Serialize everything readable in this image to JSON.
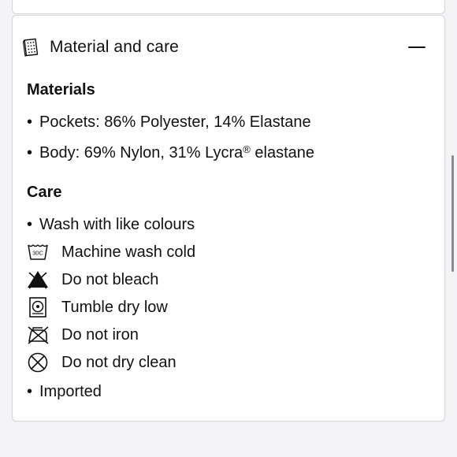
{
  "accordion": {
    "title": "Material and care",
    "icon": "care-label-icon",
    "expanded": true,
    "toggle_icon": "minus-icon"
  },
  "materials": {
    "heading": "Materials",
    "items": [
      {
        "bullet": "•",
        "text": "Pockets: 86% Polyester, 14% Elastane"
      },
      {
        "bullet": "•",
        "text": "Body: 69% Nylon, 31% Lycra",
        "registered": "®",
        "suffix": " elastane"
      }
    ]
  },
  "care": {
    "heading": "Care",
    "items": [
      {
        "type": "bullet",
        "bullet": "•",
        "text": "Wash with like colours"
      },
      {
        "type": "icon",
        "icon": "machine-wash-cold-icon",
        "icon_text": "30C",
        "text": "Machine wash cold"
      },
      {
        "type": "icon",
        "icon": "do-not-bleach-icon",
        "text": "Do not bleach"
      },
      {
        "type": "icon",
        "icon": "tumble-dry-low-icon",
        "text": "Tumble dry low"
      },
      {
        "type": "icon",
        "icon": "do-not-iron-icon",
        "text": "Do not iron"
      },
      {
        "type": "icon",
        "icon": "do-not-dry-clean-icon",
        "text": "Do not dry clean"
      },
      {
        "type": "bullet",
        "bullet": "•",
        "text": "Imported"
      }
    ]
  },
  "colors": {
    "background": "#f4f4f6",
    "card": "#ffffff",
    "border": "#d6d6da",
    "text": "#111111"
  }
}
